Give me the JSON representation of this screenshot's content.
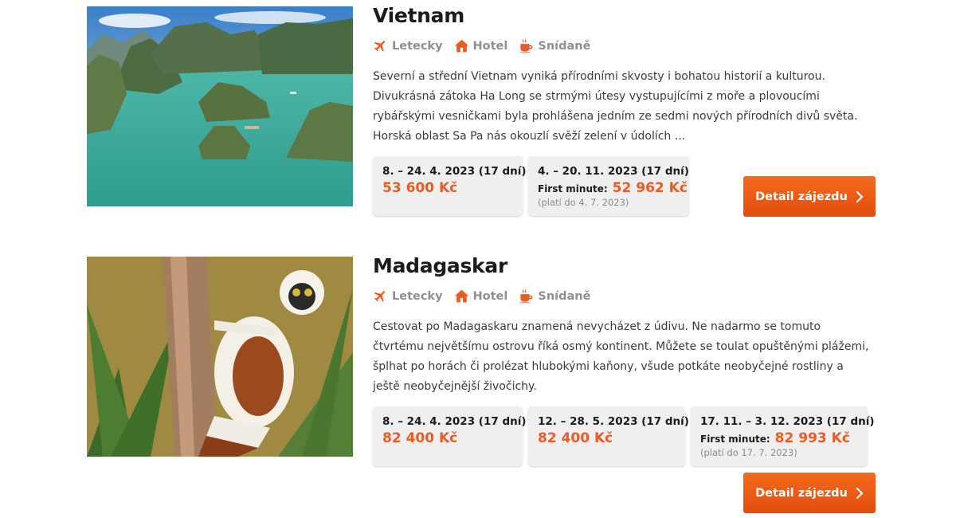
{
  "colors": {
    "accent": "#ee5b22",
    "button": "#e85812",
    "feature_icon": "#ee5b22",
    "term_bg": "#efefef"
  },
  "tours": [
    {
      "title": "Vietnam",
      "photo": "ha-long-bay-photo",
      "features": [
        {
          "icon": "plane-icon",
          "label": "Letecky"
        },
        {
          "icon": "home-icon",
          "label": "Hotel"
        },
        {
          "icon": "coffee-icon",
          "label": "Snídaně"
        }
      ],
      "description": "Severní a střední Vietnam vyniká přírodními skvosty i bohatou historií a kulturou. Divukrásná zátoka Ha Long se strmými útesy vystupujícími z moře a plovoucími rybářskými vesničkami byla prohlášena jedním ze sedmi nových přírodních divů světa. Horská oblast Sa Pa nás okouzlí svěží zelení v údolích ...",
      "terms": [
        {
          "date": "8. – 24. 4. 2023 (17 dní)",
          "price": "53 600 Kč"
        },
        {
          "date": "4. – 20. 11. 2023 (17 dní)",
          "first_minute_label": "First minute:",
          "price": "52 962 Kč",
          "valid": "(platí do 4. 7. 2023)"
        }
      ],
      "button_label": "Detail zájezdu"
    },
    {
      "title": "Madagaskar",
      "photo": "lemur-photo",
      "features": [
        {
          "icon": "plane-icon",
          "label": "Letecky"
        },
        {
          "icon": "home-icon",
          "label": "Hotel"
        },
        {
          "icon": "coffee-icon",
          "label": "Snídaně"
        }
      ],
      "description": "Cestovat po Madagaskaru znamená nevycházet z údivu. Ne nadarmo se tomuto čtvrtému největšímu ostrovu říká osmý kontinent. Můžete se toulat opuštěnými plážemi, šplhat po horách či prolézat hlubokými kaňony, všude potkáte neobyčejné rostliny a ještě neobyčejnější živočichy.",
      "terms": [
        {
          "date": "8. – 24. 4. 2023 (17 dní)",
          "price": "82 400 Kč"
        },
        {
          "date": "12. – 28. 5. 2023 (17 dní)",
          "price": "82 400 Kč"
        },
        {
          "date": "17. 11. – 3. 12. 2023 (17 dní)",
          "first_minute_label": "First minute:",
          "price": "82 993 Kč",
          "valid": "(platí do 17. 7. 2023)"
        }
      ],
      "button_label": "Detail zájezdu"
    }
  ]
}
